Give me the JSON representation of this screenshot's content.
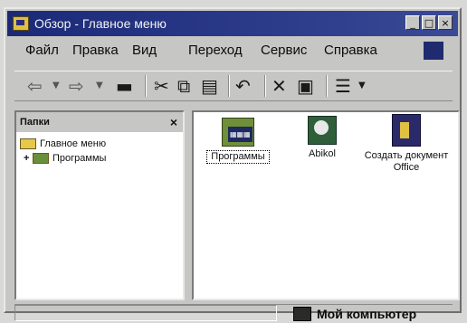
{
  "window": {
    "title": "Обзор - Главное меню",
    "controls": [
      "_",
      "□",
      "×"
    ]
  },
  "menu": [
    "Файл",
    "Правка",
    "Вид",
    "Переход",
    "Сервис",
    "Справка"
  ],
  "toolbar": {
    "icons": [
      "back-icon",
      "dropdown-icon",
      "forward-icon",
      "dropdown-icon",
      "folder-up-icon",
      "cut-icon",
      "copy-icon",
      "paste-icon",
      "undo-icon",
      "delete-icon",
      "properties-icon",
      "views-icon",
      "dropdown-icon"
    ]
  },
  "folders_pane": {
    "header": "Папки",
    "close": "×",
    "tree": [
      {
        "label": "Главное меню"
      },
      {
        "expander": "+",
        "label": "Программы"
      }
    ]
  },
  "content": {
    "items": [
      {
        "label": "Программы",
        "icon": "programs-folder-icon",
        "selected": true
      },
      {
        "label": "Abikol",
        "icon": "abikol-shortcut-icon"
      },
      {
        "label": "Создать документ Office",
        "icon": "new-office-doc-icon"
      }
    ]
  },
  "status": {
    "location": "Мой компьютер"
  }
}
